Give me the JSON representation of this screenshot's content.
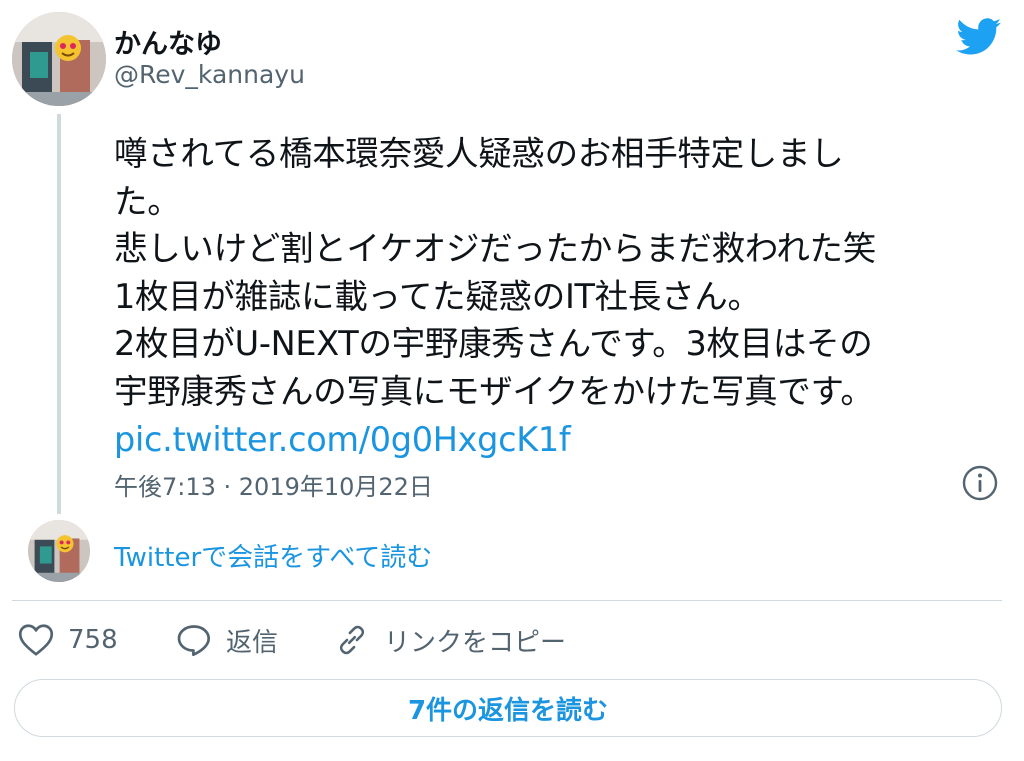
{
  "author": {
    "display_name": "かんなゆ",
    "handle": "@Rev_kannayu"
  },
  "tweet": {
    "lines": [
      "噂されてる橋本環奈愛人疑惑のお相手特定しまし",
      "た。",
      "悲しいけど割とイケオジだったからまだ救われた笑",
      "1枚目が雑誌に載ってた疑惑のIT社長さん。",
      "2枚目がU-NEXTの宇野康秀さんです。3枚目はその",
      "宇野康秀さんの写真にモザイクをかけた写真です。"
    ],
    "link_text": "pic.twitter.com/0g0HxgcK1f",
    "timestamp": "午後7:13 · 2019年10月22日"
  },
  "conversation": {
    "read_all_label": "Twitterで会話をすべて読む"
  },
  "actions": {
    "like_count": "758",
    "reply_label": "返信",
    "copy_link_label": "リンクをコピー"
  },
  "replies_button": {
    "label": "7件の返信を読む"
  },
  "icons": {
    "brand": "twitter-bird-icon",
    "info": "info-icon",
    "like": "heart-icon",
    "reply": "speech-bubble-icon",
    "copy_link": "link-icon"
  },
  "colors": {
    "twitter_blue": "#1da1f2",
    "link_blue": "#1b95e0",
    "text_primary": "#0f1419",
    "text_secondary": "#536471",
    "border": "#cfd9de"
  }
}
